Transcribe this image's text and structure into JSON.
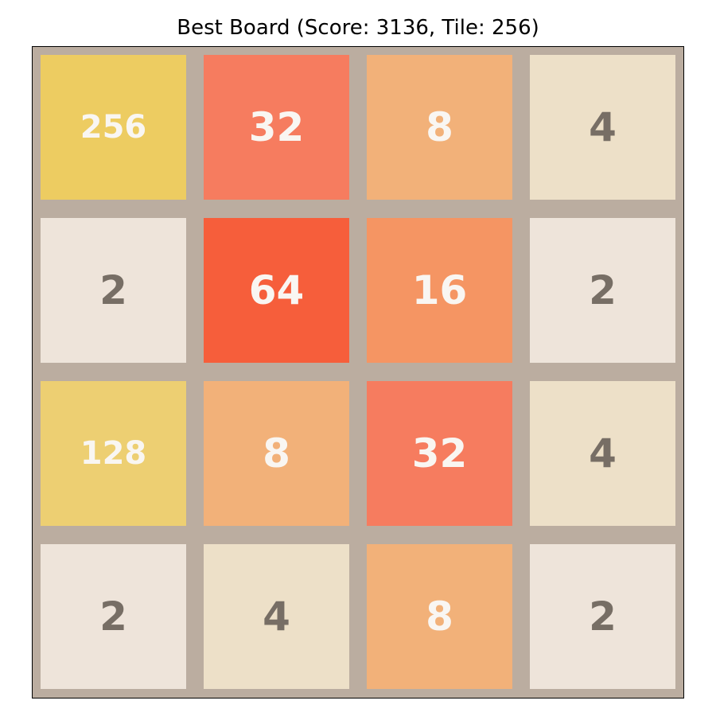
{
  "title": "Best Board (Score: 3136, Tile: 256)",
  "board": {
    "score": 3136,
    "max_tile": 256,
    "rows": 4,
    "cols": 4,
    "grid": [
      [
        "256",
        "32",
        "8",
        "4"
      ],
      [
        "2",
        "64",
        "16",
        "2"
      ],
      [
        "128",
        "8",
        "32",
        "4"
      ],
      [
        "2",
        "4",
        "8",
        "2"
      ]
    ]
  },
  "colors": {
    "board_background": "#bbada0",
    "tile_2": "#eee4da",
    "tile_4": "#ede0c8",
    "tile_8": "#f2b179",
    "tile_16": "#f59563",
    "tile_32": "#f67c5f",
    "tile_64": "#f65e3b",
    "tile_128": "#edcf72",
    "tile_256": "#edcc61",
    "text_dark": "#776e65",
    "text_light": "#f9f6f2"
  }
}
